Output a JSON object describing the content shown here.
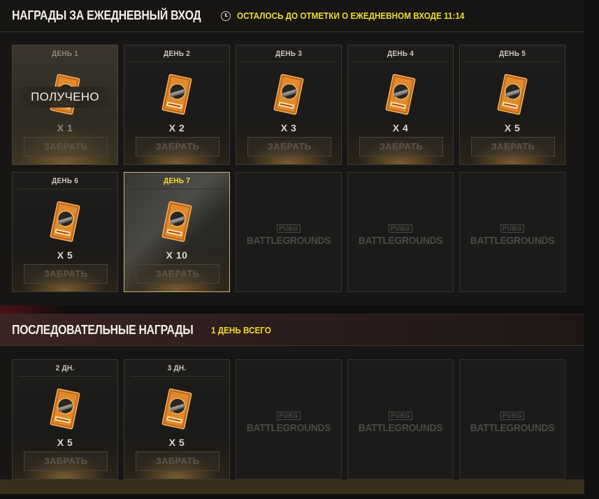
{
  "daily": {
    "title": "НАГРАДЫ ЗА ЕЖЕДНЕВНЫЙ ВХОД",
    "timer_text": "ОСТАЛОСЬ ДО ОТМЕТКИ О ЕЖЕДНЕВНОМ ВХОДЕ 11:14",
    "cards": [
      {
        "day": "ДЕНЬ 1",
        "qty": "X 1",
        "button": "ЗАБРАТЬ",
        "status": "ПОЛУЧЕНО"
      },
      {
        "day": "ДЕНЬ 2",
        "qty": "X 2",
        "button": "ЗАБРАТЬ"
      },
      {
        "day": "ДЕНЬ 3",
        "qty": "X 3",
        "button": "ЗАБРАТЬ"
      },
      {
        "day": "ДЕНЬ 4",
        "qty": "X 4",
        "button": "ЗАБРАТЬ"
      },
      {
        "day": "ДЕНЬ 5",
        "qty": "X 5",
        "button": "ЗАБРАТЬ"
      },
      {
        "day": "ДЕНЬ 6",
        "qty": "X 5",
        "button": "ЗАБРАТЬ"
      },
      {
        "day": "ДЕНЬ 7",
        "qty": "X 10",
        "button": "ЗАБРАТЬ"
      }
    ],
    "placeholders": [
      {
        "small": "PUBG",
        "big": "BATTLEGROUNDS"
      },
      {
        "small": "PUBG",
        "big": "BATTLEGROUNDS"
      },
      {
        "small": "PUBG",
        "big": "BATTLEGROUNDS"
      }
    ]
  },
  "streak": {
    "title": "ПОСЛЕДОВАТЕЛЬНЫЕ НАГРАДЫ",
    "total_text": "1 ДЕНЬ ВСЕГО",
    "cards": [
      {
        "day": "2 ДН.",
        "qty": "X 5",
        "button": "ЗАБРАТЬ"
      },
      {
        "day": "3 ДН.",
        "qty": "X 5",
        "button": "ЗАБРАТЬ"
      }
    ],
    "placeholders": [
      {
        "small": "PUBG",
        "big": "BATTLEGROUNDS"
      },
      {
        "small": "PUBG",
        "big": "BATTLEGROUNDS"
      },
      {
        "small": "PUBG",
        "big": "BATTLEGROUNDS"
      }
    ]
  },
  "colors": {
    "accent_yellow": "#f1dc2d",
    "ticket_orange": "#d9822b"
  },
  "icons": {
    "timer": "clock-icon",
    "reward": "ticket-icon"
  }
}
